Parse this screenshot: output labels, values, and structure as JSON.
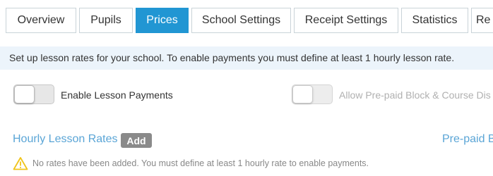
{
  "tabs": [
    {
      "label": "Overview",
      "active": false
    },
    {
      "label": "Pupils",
      "active": false
    },
    {
      "label": "Prices",
      "active": true
    },
    {
      "label": "School Settings",
      "active": false
    },
    {
      "label": "Receipt Settings",
      "active": false
    },
    {
      "label": "Statistics",
      "active": false
    },
    {
      "label": "Re",
      "active": false
    }
  ],
  "info_banner": "Set up lesson rates for your school. To enable payments you must define at least 1 hourly lesson rate.",
  "toggles": {
    "enable_payments": {
      "label": "Enable Lesson Payments",
      "on": false
    },
    "allow_prepaid": {
      "label": "Allow Pre-paid Block & Course Dis",
      "on": false,
      "disabled": true
    }
  },
  "hourly": {
    "title": "Hourly Lesson Rates",
    "add_label": "Add",
    "warning": "No rates have been added. You must define at least 1 hourly rate to enable payments."
  },
  "prepaid": {
    "title": "Pre-paid B"
  },
  "colors": {
    "accent": "#2196d3",
    "link": "#5aa5d6",
    "banner_bg": "#ecf4fb",
    "warning_icon": "#f0c419"
  }
}
